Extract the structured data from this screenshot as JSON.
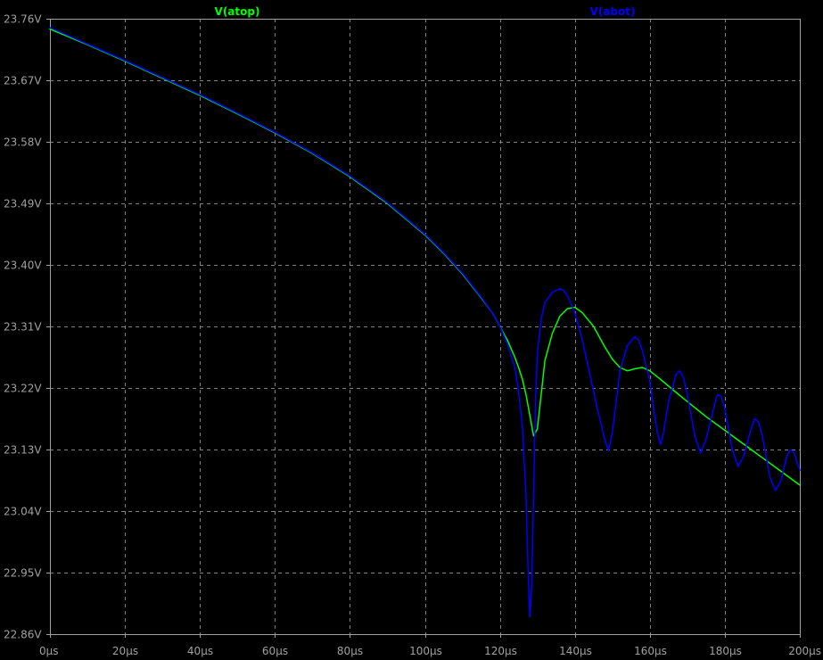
{
  "chart_data": {
    "type": "line",
    "title": "",
    "xlabel": "",
    "ylabel": "",
    "xlim": [
      0,
      200
    ],
    "ylim": [
      22.86,
      23.76
    ],
    "grid": true,
    "x_ticks": [
      {
        "value": 0,
        "label": "0µs"
      },
      {
        "value": 20,
        "label": "20µs"
      },
      {
        "value": 40,
        "label": "40µs"
      },
      {
        "value": 60,
        "label": "60µs"
      },
      {
        "value": 80,
        "label": "80µs"
      },
      {
        "value": 100,
        "label": "100µs"
      },
      {
        "value": 120,
        "label": "120µs"
      },
      {
        "value": 140,
        "label": "140µs"
      },
      {
        "value": 160,
        "label": "160µs"
      },
      {
        "value": 180,
        "label": "180µs"
      },
      {
        "value": 200,
        "label": "200µs"
      }
    ],
    "y_ticks": [
      {
        "value": 23.76,
        "label": "23.76V"
      },
      {
        "value": 23.67,
        "label": "23.67V"
      },
      {
        "value": 23.58,
        "label": "23.58V"
      },
      {
        "value": 23.49,
        "label": "23.49V"
      },
      {
        "value": 23.4,
        "label": "23.40V"
      },
      {
        "value": 23.31,
        "label": "23.31V"
      },
      {
        "value": 23.22,
        "label": "23.22V"
      },
      {
        "value": 23.13,
        "label": "23.13V"
      },
      {
        "value": 23.04,
        "label": "23.04V"
      },
      {
        "value": 22.95,
        "label": "22.95V"
      },
      {
        "value": 22.86,
        "label": "22.86V"
      }
    ],
    "series": [
      {
        "name": "V(atop)",
        "color": "#00ff00",
        "x": [
          0,
          10,
          20,
          30,
          40,
          50,
          60,
          70,
          80,
          90,
          100,
          105,
          110,
          115,
          118,
          120,
          122,
          124,
          125,
          126,
          127,
          128,
          129,
          130,
          131,
          132,
          134,
          136,
          138,
          140,
          142,
          145,
          148,
          150,
          152,
          154,
          156,
          158,
          160,
          163,
          166,
          170,
          175,
          180,
          185,
          190,
          195,
          200
        ],
        "y": [
          23.745,
          23.722,
          23.698,
          23.673,
          23.648,
          23.621,
          23.593,
          23.563,
          23.529,
          23.49,
          23.444,
          23.417,
          23.387,
          23.352,
          23.33,
          23.31,
          23.29,
          23.265,
          23.25,
          23.233,
          23.21,
          23.18,
          23.15,
          23.16,
          23.21,
          23.26,
          23.3,
          23.325,
          23.336,
          23.338,
          23.33,
          23.31,
          23.28,
          23.262,
          23.25,
          23.245,
          23.248,
          23.25,
          23.245,
          23.232,
          23.218,
          23.2,
          23.178,
          23.158,
          23.138,
          23.118,
          23.098,
          23.078
        ]
      },
      {
        "name": "V(abot)",
        "color": "#0000ff",
        "x": [
          0,
          10,
          20,
          30,
          40,
          50,
          60,
          70,
          80,
          90,
          100,
          105,
          110,
          115,
          118,
          120,
          122,
          124,
          125,
          126,
          127,
          127.5,
          128,
          128.5,
          129,
          129.5,
          130,
          131,
          132,
          134,
          136,
          137,
          138,
          140,
          142,
          144,
          146,
          148,
          149,
          150,
          151,
          152,
          154,
          156,
          157,
          158,
          160,
          161,
          162,
          162.8,
          163.5,
          165,
          167,
          168,
          169,
          170,
          171,
          172,
          173.5,
          175,
          177,
          178,
          179,
          180,
          181,
          182,
          183.5,
          185,
          187,
          188,
          189,
          190,
          191,
          192,
          193.5,
          195,
          196.5,
          197.5,
          198.5,
          199.3,
          200
        ],
        "y": [
          23.747,
          23.723,
          23.699,
          23.674,
          23.649,
          23.622,
          23.594,
          23.564,
          23.53,
          23.491,
          23.445,
          23.418,
          23.388,
          23.353,
          23.33,
          23.31,
          23.285,
          23.25,
          23.215,
          23.165,
          23.06,
          22.96,
          22.885,
          22.93,
          23.06,
          23.2,
          23.27,
          23.32,
          23.345,
          23.36,
          23.365,
          23.363,
          23.355,
          23.33,
          23.29,
          23.24,
          23.19,
          23.145,
          23.128,
          23.155,
          23.2,
          23.245,
          23.282,
          23.295,
          23.29,
          23.275,
          23.23,
          23.19,
          23.155,
          23.137,
          23.15,
          23.2,
          23.24,
          23.245,
          23.235,
          23.21,
          23.18,
          23.15,
          23.125,
          23.145,
          23.19,
          23.21,
          23.208,
          23.19,
          23.16,
          23.13,
          23.105,
          23.12,
          23.16,
          23.175,
          23.17,
          23.15,
          23.12,
          23.09,
          23.07,
          23.085,
          23.12,
          23.13,
          23.125,
          23.11,
          23.1
        ]
      }
    ]
  }
}
